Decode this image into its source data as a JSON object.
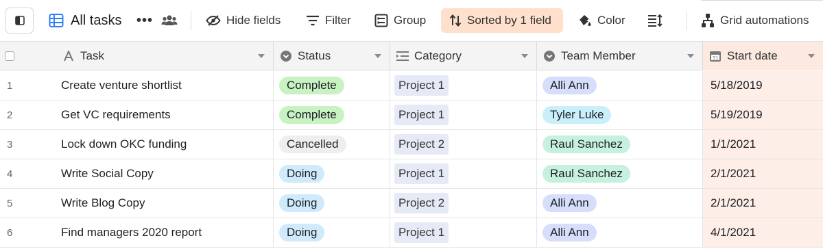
{
  "toolbar": {
    "view_name": "All tasks",
    "more_label": "•••",
    "hide_fields": "Hide fields",
    "filter": "Filter",
    "group": "Group",
    "sorted": "Sorted by 1 field",
    "color": "Color",
    "automations": "Grid automations"
  },
  "columns": {
    "task": "Task",
    "status": "Status",
    "category": "Category",
    "team_member": "Team Member",
    "start_date": "Start date"
  },
  "rows": [
    {
      "num": "1",
      "task": "Create venture shortlist",
      "status": "Complete",
      "category": "Project 1",
      "member": "Alli Ann",
      "start": "5/18/2019"
    },
    {
      "num": "2",
      "task": "Get VC requirements",
      "status": "Complete",
      "category": "Project 1",
      "member": "Tyler Luke",
      "start": "5/19/2019"
    },
    {
      "num": "3",
      "task": "Lock down OKC funding",
      "status": "Cancelled",
      "category": "Project 2",
      "member": "Raul Sanchez",
      "start": "1/1/2021"
    },
    {
      "num": "4",
      "task": "Write Social Copy",
      "status": "Doing",
      "category": "Project 1",
      "member": "Raul Sanchez",
      "start": "2/1/2021"
    },
    {
      "num": "5",
      "task": "Write Blog Copy",
      "status": "Doing",
      "category": "Project 2",
      "member": "Alli Ann",
      "start": "2/1/2021"
    },
    {
      "num": "6",
      "task": "Find managers 2020 report",
      "status": "Doing",
      "category": "Project 1",
      "member": "Alli Ann",
      "start": "4/1/2021"
    }
  ],
  "colors": {
    "sorted_highlight": "#ffe0cc",
    "sorted_column": "#fdeee7",
    "status_complete": "#c8f2c2",
    "status_cancelled": "#eeeeee",
    "status_doing": "#cfeafb",
    "grid_icon": "#2d7ff9"
  },
  "icons": {
    "sidebar_toggle": "sidebar-toggle-icon",
    "view": "grid-view-icon",
    "collaborators": "people-icon",
    "hide_fields": "eye-slash-icon",
    "filter": "filter-icon",
    "group": "group-icon",
    "sort": "sort-arrows-icon",
    "color": "paint-bucket-icon",
    "row_height": "row-height-icon",
    "automations": "automation-icon"
  }
}
